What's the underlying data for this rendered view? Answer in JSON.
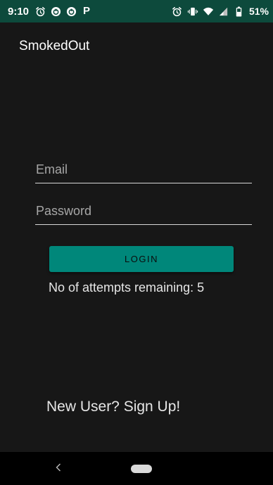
{
  "status_bar": {
    "time": "9:10",
    "left_icons": [
      "alarm-icon",
      "circle-app-icon",
      "circle-app-icon",
      "p-app-icon"
    ],
    "p_icon_letter": "P",
    "right_icons": [
      "alarm-icon",
      "vibrate-icon",
      "wifi-icon",
      "signal-icon",
      "battery-icon"
    ],
    "battery_percent": "51%",
    "background_color": "#0d4a3c"
  },
  "app": {
    "title": "SmokedOut"
  },
  "login_form": {
    "email": {
      "placeholder": "Email",
      "value": ""
    },
    "password": {
      "placeholder": "Password",
      "value": ""
    },
    "login_button_label": "LOGIN",
    "attempts_text": "No of attempts remaining: 5"
  },
  "signup": {
    "label": "New User? Sign Up!"
  },
  "nav_bar": {
    "back_icon": "back-chevron-icon",
    "home_icon": "home-pill-icon"
  },
  "colors": {
    "background": "#171717",
    "accent": "#00877a",
    "status_bar": "#0d4a3c",
    "nav_bar": "#000000"
  }
}
